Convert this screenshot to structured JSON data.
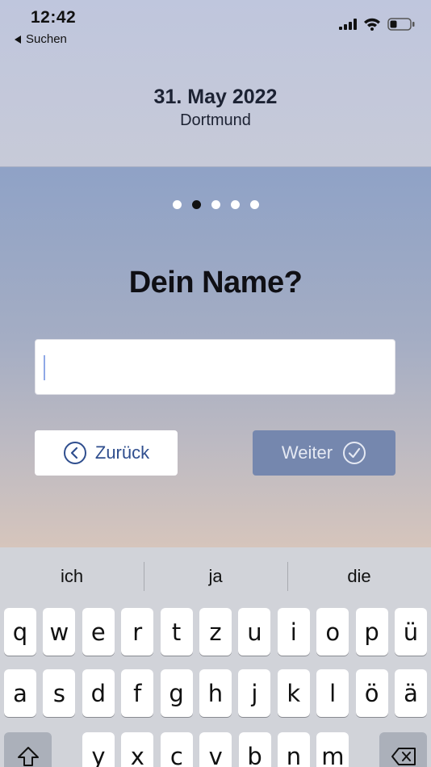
{
  "status_bar": {
    "time": "12:42",
    "back_app": "Suchen",
    "icons": [
      "cellular-signal-icon",
      "wifi-icon",
      "battery-icon"
    ]
  },
  "event": {
    "date": "31. May 2022",
    "city": "Dortmund"
  },
  "progress": {
    "total_steps": 5,
    "current_step": 2
  },
  "form": {
    "question": "Dein Name?",
    "name_value": ""
  },
  "buttons": {
    "back_label": "Zurück",
    "back_icon": "chevron-left-circle-icon",
    "next_label": "Weiter",
    "next_icon": "check-circle-icon"
  },
  "keyboard": {
    "suggestions": [
      "ich",
      "ja",
      "die"
    ],
    "row1": [
      "q",
      "w",
      "e",
      "r",
      "t",
      "z",
      "u",
      "i",
      "o",
      "p",
      "ü"
    ],
    "row2": [
      "a",
      "s",
      "d",
      "f",
      "g",
      "h",
      "j",
      "k",
      "l",
      "ö",
      "ä"
    ],
    "row3": [
      "y",
      "x",
      "c",
      "v",
      "b",
      "n",
      "m"
    ],
    "shift_icon": "shift-icon",
    "delete_icon": "backspace-icon"
  },
  "colors": {
    "accent": "#2f4e8e",
    "next_button": "#7587ae",
    "active_dot": "#111111"
  }
}
